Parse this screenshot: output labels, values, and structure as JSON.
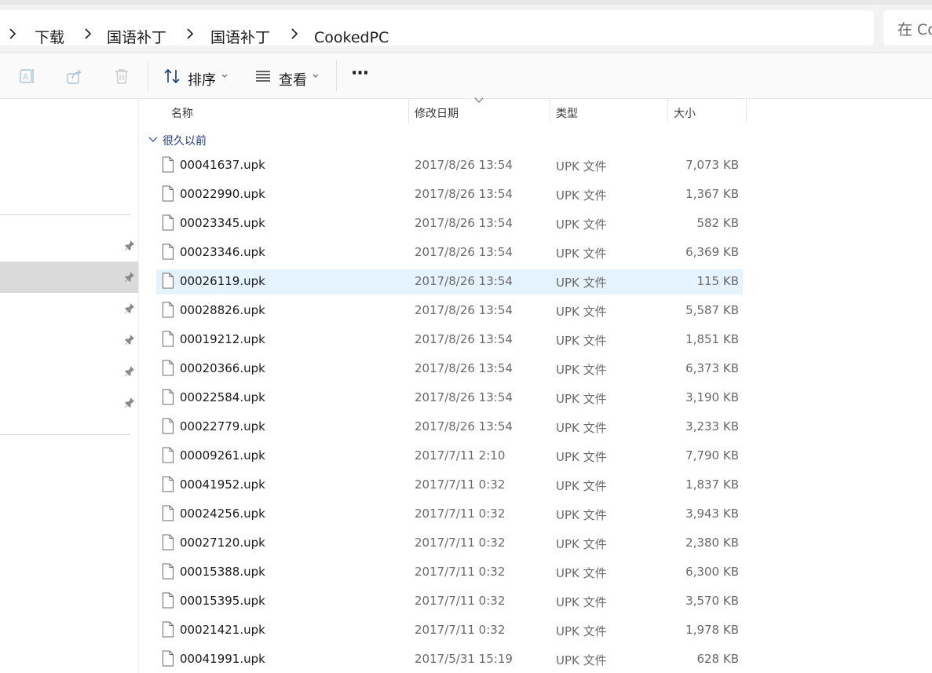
{
  "breadcrumb": {
    "items": [
      {
        "label": "下载"
      },
      {
        "label": "国语补丁"
      },
      {
        "label": "国语补丁"
      },
      {
        "label": "CookedPC"
      }
    ]
  },
  "search": {
    "placeholder": "在 Co"
  },
  "toolbar": {
    "sort_label": "排序",
    "view_label": "查看",
    "more_label": "···"
  },
  "columns": {
    "name": "名称",
    "date": "修改日期",
    "type": "类型",
    "size": "大小"
  },
  "group": {
    "label": "很久以前"
  },
  "files": [
    {
      "name": "00041637.upk",
      "date": "2017/8/26 13:54",
      "type": "UPK 文件",
      "size": "7,073 KB"
    },
    {
      "name": "00022990.upk",
      "date": "2017/8/26 13:54",
      "type": "UPK 文件",
      "size": "1,367 KB"
    },
    {
      "name": "00023345.upk",
      "date": "2017/8/26 13:54",
      "type": "UPK 文件",
      "size": "582 KB"
    },
    {
      "name": "00023346.upk",
      "date": "2017/8/26 13:54",
      "type": "UPK 文件",
      "size": "6,369 KB"
    },
    {
      "name": "00026119.upk",
      "date": "2017/8/26 13:54",
      "type": "UPK 文件",
      "size": "115 KB"
    },
    {
      "name": "00028826.upk",
      "date": "2017/8/26 13:54",
      "type": "UPK 文件",
      "size": "5,587 KB"
    },
    {
      "name": "00019212.upk",
      "date": "2017/8/26 13:54",
      "type": "UPK 文件",
      "size": "1,851 KB"
    },
    {
      "name": "00020366.upk",
      "date": "2017/8/26 13:54",
      "type": "UPK 文件",
      "size": "6,373 KB"
    },
    {
      "name": "00022584.upk",
      "date": "2017/8/26 13:54",
      "type": "UPK 文件",
      "size": "3,190 KB"
    },
    {
      "name": "00022779.upk",
      "date": "2017/8/26 13:54",
      "type": "UPK 文件",
      "size": "3,233 KB"
    },
    {
      "name": "00009261.upk",
      "date": "2017/7/11 2:10",
      "type": "UPK 文件",
      "size": "7,790 KB"
    },
    {
      "name": "00041952.upk",
      "date": "2017/7/11 0:32",
      "type": "UPK 文件",
      "size": "1,837 KB"
    },
    {
      "name": "00024256.upk",
      "date": "2017/7/11 0:32",
      "type": "UPK 文件",
      "size": "3,943 KB"
    },
    {
      "name": "00027120.upk",
      "date": "2017/7/11 0:32",
      "type": "UPK 文件",
      "size": "2,380 KB"
    },
    {
      "name": "00015388.upk",
      "date": "2017/7/11 0:32",
      "type": "UPK 文件",
      "size": "6,300 KB"
    },
    {
      "name": "00015395.upk",
      "date": "2017/7/11 0:32",
      "type": "UPK 文件",
      "size": "3,570 KB"
    },
    {
      "name": "00021421.upk",
      "date": "2017/7/11 0:32",
      "type": "UPK 文件",
      "size": "1,978 KB"
    },
    {
      "name": "00041991.upk",
      "date": "2017/5/31 15:19",
      "type": "UPK 文件",
      "size": "628 KB"
    }
  ],
  "colors": {
    "selection": "#e5f3ff",
    "nav_active": "#dadada",
    "group_header": "#1f3b78"
  }
}
